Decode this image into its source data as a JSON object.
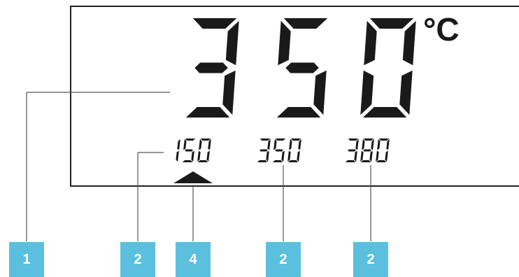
{
  "display": {
    "main_temperature": "350",
    "unit": "°C",
    "presets": [
      "150",
      "350",
      "380"
    ],
    "active_preset_indicator": "up-triangle-icon"
  },
  "callouts": [
    {
      "label": "1",
      "points_to": "main-temperature-readout"
    },
    {
      "label": "2",
      "points_to": "preset-150"
    },
    {
      "label": "4",
      "points_to": "active-preset-indicator"
    },
    {
      "label": "2",
      "points_to": "preset-350"
    },
    {
      "label": "2",
      "points_to": "preset-380"
    }
  ],
  "colors": {
    "callout_fill": "#5bc0de",
    "lcd_segment": "#1a1a1a",
    "leader_line": "#555555",
    "bezel": "#222222",
    "background": "#ffffff"
  }
}
